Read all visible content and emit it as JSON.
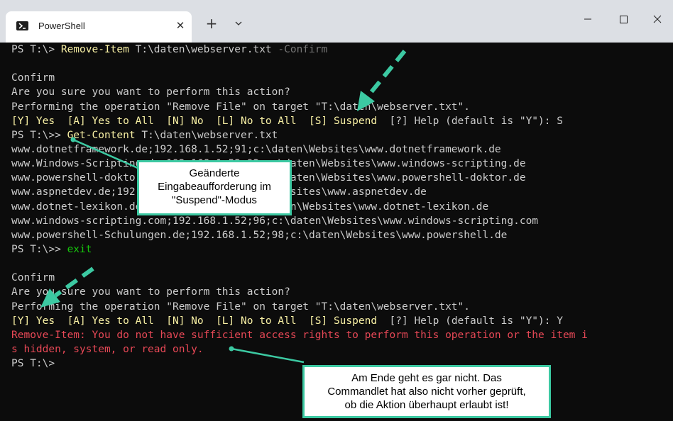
{
  "window": {
    "tab_title": "PowerShell",
    "tab_icon": "powershell-icon",
    "close_tab_glyph": "✕",
    "new_tab_glyph": "+",
    "accent_color": "#3cc9a2"
  },
  "terminal": {
    "colors": {
      "background": "#0c0c0c",
      "text": "#cccccc",
      "command": "#f9f1a5",
      "parameter": "#767676",
      "green": "#16c60c",
      "error": "#e74856"
    },
    "lines": [
      [
        {
          "t": "PS T:\\> ",
          "c": "white"
        },
        {
          "t": "Remove-Item",
          "c": "yellow"
        },
        {
          "t": " T:\\daten\\webserver.txt ",
          "c": "white"
        },
        {
          "t": "-Confirm",
          "c": "gray"
        }
      ],
      [
        {
          "t": "",
          "c": "white"
        }
      ],
      [
        {
          "t": "Confirm",
          "c": "white"
        }
      ],
      [
        {
          "t": "Are you sure you want to perform this action?",
          "c": "white"
        }
      ],
      [
        {
          "t": "Performing the operation \"Remove File\" on target \"T:\\daten\\webserver.txt\".",
          "c": "white"
        }
      ],
      [
        {
          "t": "[Y] Yes  [A] Yes to All  [N] No  [L] No to All  [S] Suspend",
          "c": "yellow"
        },
        {
          "t": "  [?] Help (default is \"Y\"): S",
          "c": "white"
        }
      ],
      [
        {
          "t": "PS T:\\>> ",
          "c": "white"
        },
        {
          "t": "Get-Content",
          "c": "yellow"
        },
        {
          "t": " T:\\daten\\webserver.txt",
          "c": "white"
        }
      ],
      [
        {
          "t": "www.dotnetframework.de;192.168.1.52;91;c:\\daten\\Websites\\www.dotnetframework.de",
          "c": "white"
        }
      ],
      [
        {
          "t": "www.Windows-Scripting.de;192.168.1.52;92;c:\\daten\\Websites\\www.windows-scripting.de",
          "c": "white"
        }
      ],
      [
        {
          "t": "www.powershell-doktor.de;192.168.1.52;93;c:\\daten\\Websites\\www.powershell-doktor.de",
          "c": "white"
        }
      ],
      [
        {
          "t": "www.aspnetdev.de;192.168.1.52;94;c:\\daten\\Websites\\www.aspnetdev.de",
          "c": "white"
        }
      ],
      [
        {
          "t": "www.dotnet-lexikon.de;192.168.1.52;95;c:\\daten\\Websites\\www.dotnet-lexikon.de",
          "c": "white"
        }
      ],
      [
        {
          "t": "www.windows-scripting.com;192.168.1.52;96;c:\\daten\\Websites\\www.windows-scripting.com",
          "c": "white"
        }
      ],
      [
        {
          "t": "www.powershell-Schulungen.de;192.168.1.52;98;c:\\daten\\Websites\\www.powershell.de",
          "c": "white"
        }
      ],
      [
        {
          "t": "PS T:\\>> ",
          "c": "white"
        },
        {
          "t": "exit",
          "c": "green"
        }
      ],
      [
        {
          "t": "",
          "c": "white"
        }
      ],
      [
        {
          "t": "Confirm",
          "c": "white"
        }
      ],
      [
        {
          "t": "Are you sure you want to perform this action?",
          "c": "white"
        }
      ],
      [
        {
          "t": "Performing the operation \"Remove File\" on target \"T:\\daten\\webserver.txt\".",
          "c": "white"
        }
      ],
      [
        {
          "t": "[Y] Yes  [A] Yes to All  [N] No  [L] No to All  [S] Suspend",
          "c": "yellow"
        },
        {
          "t": "  [?] Help (default is \"Y\"): Y",
          "c": "white"
        }
      ],
      [
        {
          "t": "Remove-Item: You do not have sufficient access rights to perform this operation or the item i",
          "c": "red"
        }
      ],
      [
        {
          "t": "s hidden, system, or read only.",
          "c": "red"
        }
      ],
      [
        {
          "t": "PS T:\\>",
          "c": "white"
        }
      ]
    ]
  },
  "callouts": [
    {
      "lines": [
        "Geänderte",
        "Eingabeaufforderung im",
        "\"Suspend\"-Modus"
      ]
    },
    {
      "lines": [
        "Am Ende geht es gar nicht. Das",
        "Commandlet hat also nicht vorher geprüft,",
        "ob die Aktion überhaupt erlaubt ist!"
      ]
    }
  ]
}
